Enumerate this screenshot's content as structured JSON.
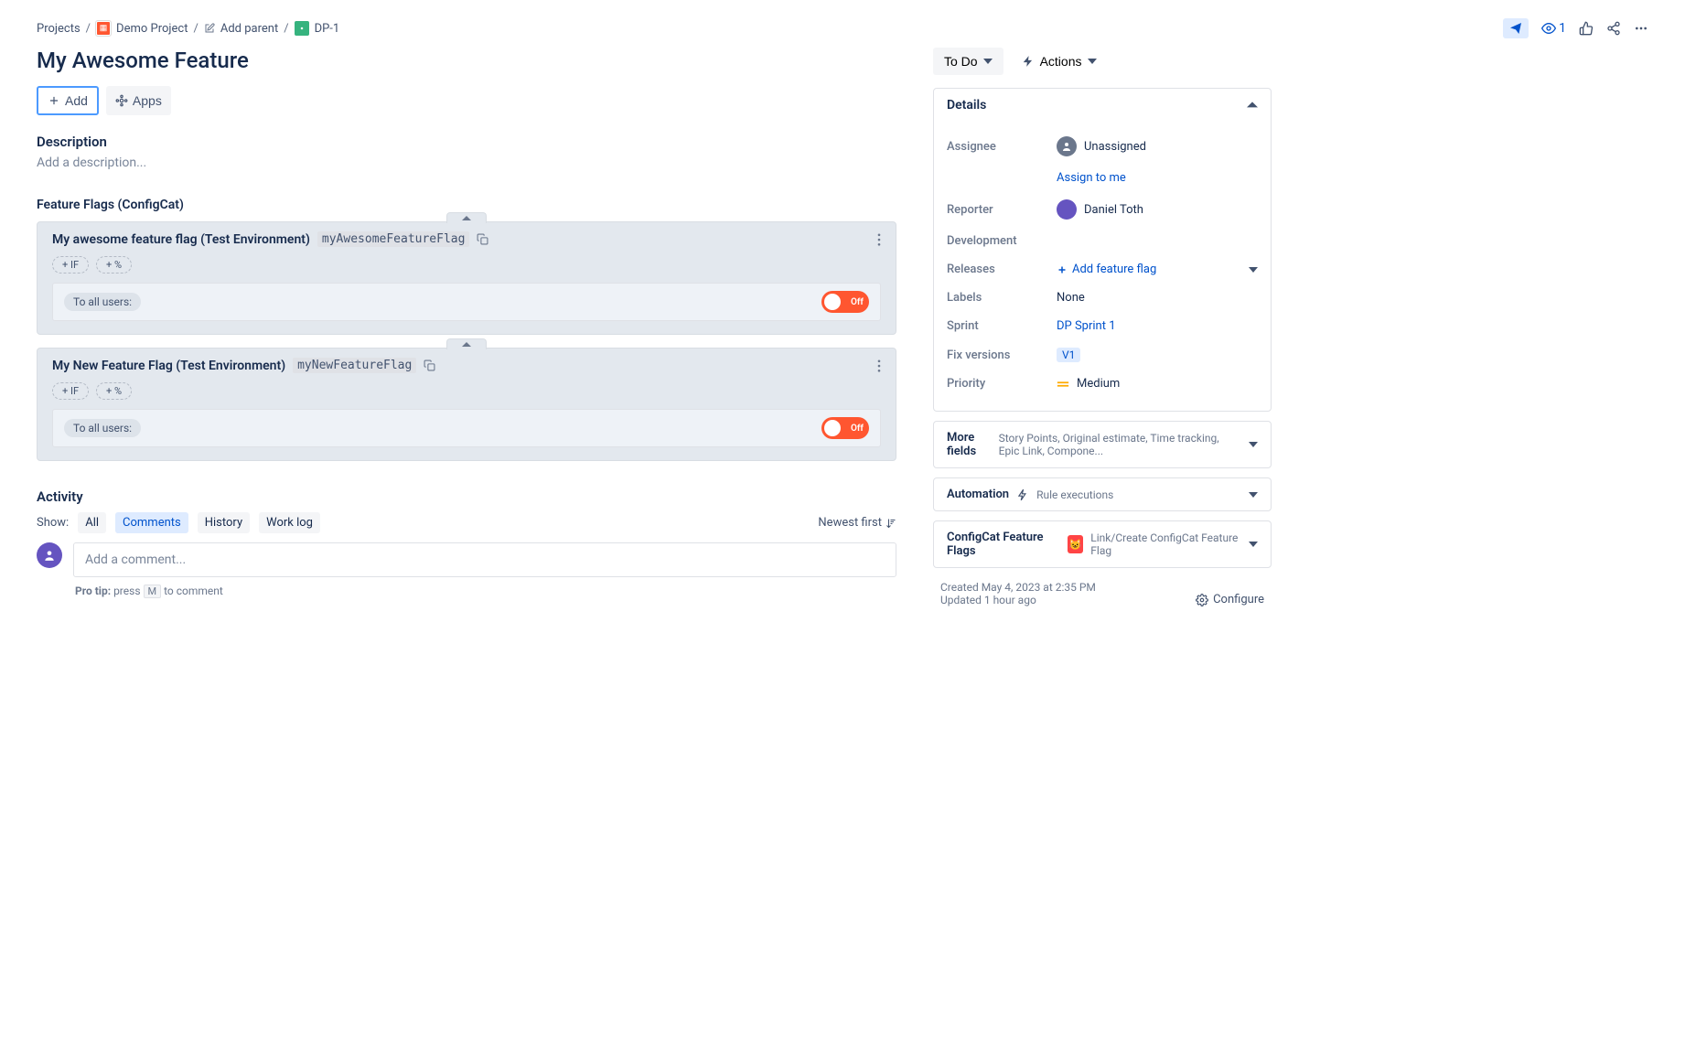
{
  "breadcrumb": {
    "projects": "Projects",
    "project": "Demo Project",
    "add_parent": "Add parent",
    "issue_key": "DP-1"
  },
  "top_actions": {
    "watchers": "1"
  },
  "issue": {
    "title": "My Awesome Feature"
  },
  "toolbar": {
    "add": "Add",
    "apps": "Apps"
  },
  "description": {
    "heading": "Description",
    "placeholder": "Add a description..."
  },
  "flags": {
    "heading": "Feature Flags (ConfigCat)",
    "items": [
      {
        "name": "My awesome feature flag (Test Environment)",
        "key": "myAwesomeFeatureFlag",
        "rule_if": "+ IF",
        "rule_pct": "+ %",
        "to_users": "To all users:",
        "toggle_label": "Off",
        "toggle_state": "off"
      },
      {
        "name": "My New Feature Flag (Test Environment)",
        "key": "myNewFeatureFlag",
        "rule_if": "+ IF",
        "rule_pct": "+ %",
        "to_users": "To all users:",
        "toggle_label": "Off",
        "toggle_state": "off"
      }
    ]
  },
  "activity": {
    "heading": "Activity",
    "show": "Show:",
    "tabs": [
      "All",
      "Comments",
      "History",
      "Work log"
    ],
    "selected_tab": "Comments",
    "newest_first": "Newest first",
    "comment_placeholder": "Add a comment...",
    "pro_tip_label": "Pro tip:",
    "pro_tip_press": "press",
    "pro_tip_key": "M",
    "pro_tip_rest": "to comment"
  },
  "right": {
    "status": "To Do",
    "actions": "Actions",
    "details_title": "Details",
    "fields": {
      "assignee_label": "Assignee",
      "assignee_value": "Unassigned",
      "assign_to_me": "Assign to me",
      "reporter_label": "Reporter",
      "reporter_value": "Daniel Toth",
      "development_label": "Development",
      "releases_label": "Releases",
      "add_feature_flag": "Add feature flag",
      "labels_label": "Labels",
      "labels_value": "None",
      "sprint_label": "Sprint",
      "sprint_value": "DP Sprint 1",
      "fix_versions_label": "Fix versions",
      "fix_versions_value": "V1",
      "priority_label": "Priority",
      "priority_value": "Medium"
    },
    "more_fields": {
      "title": "More fields",
      "hint": "Story Points, Original estimate, Time tracking, Epic Link, Compone..."
    },
    "automation": {
      "title": "Automation",
      "hint": "Rule executions"
    },
    "configcat": {
      "title": "ConfigCat Feature Flags",
      "hint": "Link/Create ConfigCat Feature Flag"
    },
    "timestamps": {
      "created": "Created May 4, 2023 at 2:35 PM",
      "updated": "Updated 1 hour ago"
    },
    "configure": "Configure"
  }
}
